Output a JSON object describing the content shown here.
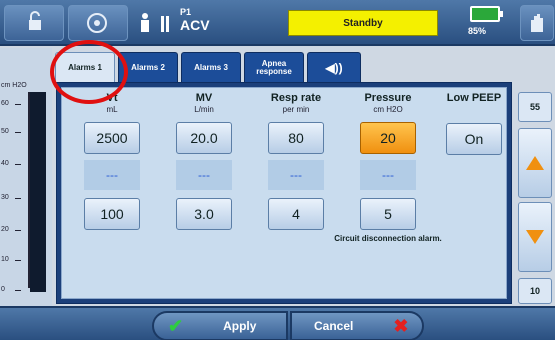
{
  "topbar": {
    "mode_small": "P1",
    "mode": "ACV",
    "status": "Standby",
    "battery_pct": "85%"
  },
  "gauge": {
    "unit": "cm H2O",
    "ticks": [
      "60",
      "50",
      "40",
      "30",
      "20",
      "10",
      "0"
    ]
  },
  "tabs": [
    {
      "label": "Alarms 1"
    },
    {
      "label": "Alarms 2"
    },
    {
      "label": "Alarms 3"
    },
    {
      "label": "Apnea response"
    },
    {
      "label": "◀))"
    }
  ],
  "columns": [
    {
      "title": "Vt",
      "unit": "mL",
      "high": "2500",
      "mid": "---",
      "low": "100"
    },
    {
      "title": "MV",
      "unit": "L/min",
      "high": "20.0",
      "mid": "---",
      "low": "3.0"
    },
    {
      "title": "Resp rate",
      "unit": "per min",
      "high": "80",
      "mid": "---",
      "low": "4"
    },
    {
      "title": "Pressure",
      "unit": "cm H2O",
      "high": "20",
      "mid": "---",
      "low": "5",
      "note": "Circuit disconnection alarm."
    },
    {
      "title": "Low PEEP",
      "unit": "",
      "high": "On"
    }
  ],
  "right": {
    "top_value": "55",
    "bottom_value": "10"
  },
  "bottombar": {
    "apply_label": "Apply",
    "cancel_label": "Cancel"
  },
  "colors": {
    "highlight": "#f09010",
    "status_bg": "#f4f000",
    "annotation": "#e01010"
  }
}
